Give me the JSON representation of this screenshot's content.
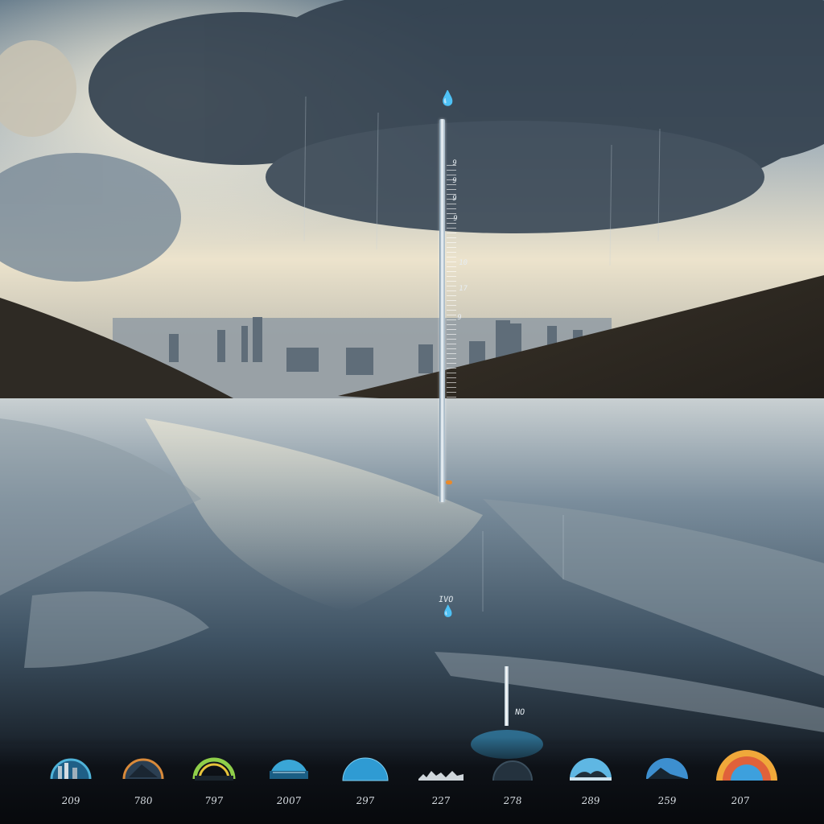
{
  "scene": {
    "sky_colors": [
      "#e9e2cf",
      "#7d8d9c",
      "#2d3a48"
    ],
    "water_color": "#6f8191",
    "hill_color": "#2a2620"
  },
  "gauge": {
    "drop_icon": "water-drop-icon",
    "tick_labels": [
      "9",
      "9",
      "9",
      "9",
      "10",
      "17",
      "9"
    ],
    "mid_reading": "IVO",
    "low_reading": "NO"
  },
  "widgets": [
    {
      "caption": "",
      "value": "209",
      "icon": "city-scene-icon",
      "accent": "#4fb3d9"
    },
    {
      "caption": "",
      "value": "780",
      "icon": "sunset-arc-icon",
      "accent": "#d98a3a"
    },
    {
      "caption": "",
      "value": "797",
      "icon": "rainbow-gauge-icon",
      "accent": "#8fcf4a"
    },
    {
      "caption": "",
      "value": "2007",
      "icon": "water-scene-icon",
      "accent": "#3aa6d6"
    },
    {
      "caption": "",
      "value": "297",
      "icon": "sky-dome-icon",
      "accent": "#2f9bd3"
    },
    {
      "caption": "",
      "value": "227",
      "icon": "skyline-icon",
      "accent": "#cfd6db"
    },
    {
      "caption": "",
      "value": "278",
      "icon": "dark-dome-icon",
      "accent": "#3b4f5e"
    },
    {
      "caption": "",
      "value": "289",
      "icon": "cloud-scene-icon",
      "accent": "#5fb7e3"
    },
    {
      "caption": "",
      "value": "259",
      "icon": "landscape-icon",
      "accent": "#3d8fcf"
    },
    {
      "caption": "",
      "value": "207",
      "icon": "rainbow-arc-icon",
      "accent": "#f0a83a"
    }
  ]
}
